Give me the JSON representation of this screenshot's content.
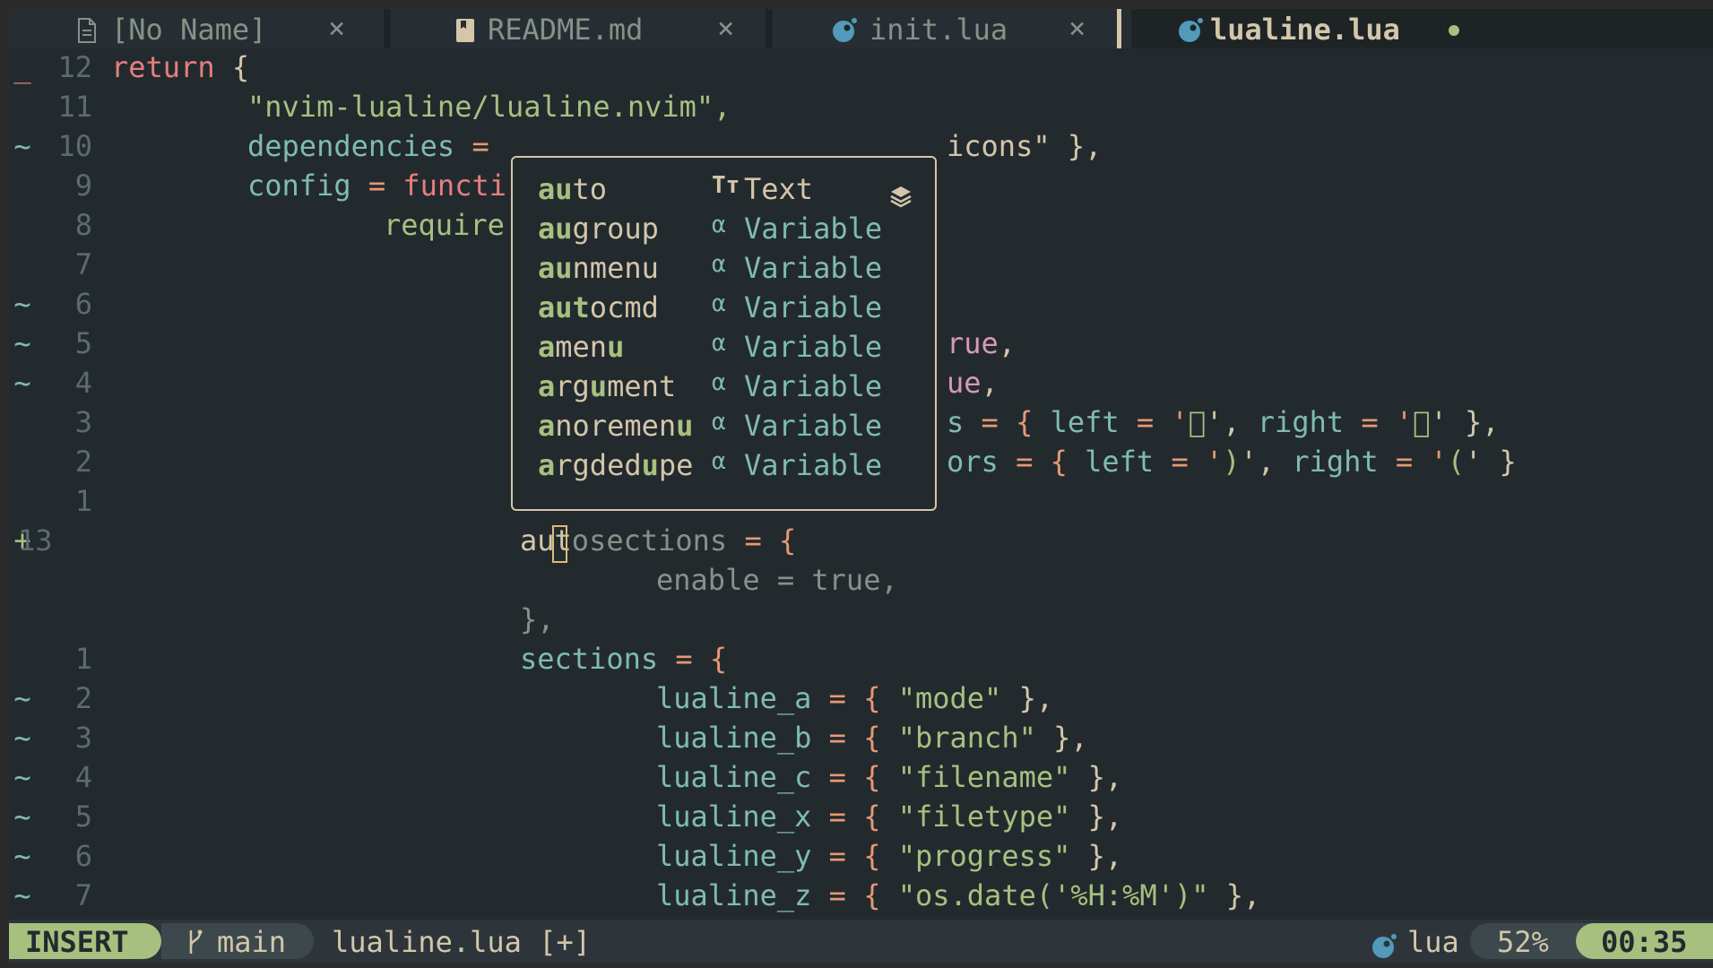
{
  "colors": {
    "background": "#232a2e",
    "accent_green": "#a7c080",
    "keyword_red": "#e67e80",
    "ident_aqua": "#7fbbb3",
    "operator_orange": "#e69875",
    "fg": "#d3c6aa"
  },
  "tabs": [
    {
      "title": "[No Name]",
      "icon": "file-icon",
      "close": "×",
      "active": false
    },
    {
      "title": "README.md",
      "icon": "markdown-file-icon",
      "close": "×",
      "active": false
    },
    {
      "title": "init.lua",
      "icon": "lua-icon",
      "close": "×",
      "active": false
    },
    {
      "title": "lualine.lua",
      "icon": "lua-icon",
      "modified": true,
      "active": true
    }
  ],
  "lines": [
    {
      "sign": "_",
      "num": "12"
    },
    {
      "sign": "",
      "num": "11"
    },
    {
      "sign": "~",
      "num": "10"
    },
    {
      "sign": "",
      "num": "9"
    },
    {
      "sign": "",
      "num": "8"
    },
    {
      "sign": "",
      "num": "7"
    },
    {
      "sign": "~",
      "num": "6"
    },
    {
      "sign": "~",
      "num": "5"
    },
    {
      "sign": "~",
      "num": "4"
    },
    {
      "sign": "",
      "num": "3"
    },
    {
      "sign": "",
      "num": "2"
    },
    {
      "sign": "",
      "num": "1"
    },
    {
      "sign": "+",
      "num": "13"
    },
    {
      "sign": "",
      "num": ""
    },
    {
      "sign": "",
      "num": ""
    },
    {
      "sign": "",
      "num": "1"
    },
    {
      "sign": "~",
      "num": "2"
    },
    {
      "sign": "~",
      "num": "3"
    },
    {
      "sign": "~",
      "num": "4"
    },
    {
      "sign": "~",
      "num": "5"
    },
    {
      "sign": "~",
      "num": "6"
    },
    {
      "sign": "~",
      "num": "7"
    }
  ],
  "code": {
    "l0_return": "return",
    "l0_brace": " {",
    "l1": "\"nvim-lualine/lualine.nvim\",",
    "l2_id": "dependencies",
    "l2_op": " =",
    "l2_tail": "icons\" },",
    "l3_id": "config",
    "l3_op": " = ",
    "l3_kw": "functi",
    "l4": "require",
    "l7_tail_a": "rue",
    "l7_tail_b": ",",
    "l8_tail_a": "ue",
    "l8_tail_b": ",",
    "l9_a": "s",
    "l9_b": " = { ",
    "l9_c": "left",
    "l9_d": " = '",
    "l9_e": "",
    "l9_f": "', ",
    "l9_g": "right",
    "l9_h": " = '",
    "l9_i": "",
    "l9_j": "' },",
    "l10_a": "ors",
    "l10_b": " = { ",
    "l10_c": "left",
    "l10_d": " = '",
    "l10_e": ")",
    "l10_f": "', ",
    "l10_g": "right",
    "l10_h": " = '",
    "l10_i": "(",
    "l10_j": "' }",
    "l12_a": "au",
    "l12_b": "t",
    "l12_c": "osections",
    "l12_d": " = {",
    "l13_a": "enable",
    "l13_b": " = ",
    "l13_c": "true",
    "l13_d": ",",
    "l14": "},",
    "l15_a": "sections",
    "l15_b": " = {",
    "sec": [
      {
        "name": "lualine_a",
        "val": "\"mode\""
      },
      {
        "name": "lualine_b",
        "val": "\"branch\""
      },
      {
        "name": "lualine_c",
        "val": "\"filename\""
      },
      {
        "name": "lualine_x",
        "val": "\"filetype\""
      },
      {
        "name": "lualine_y",
        "val": "\"progress\""
      },
      {
        "name": "lualine_z",
        "val": "\"os.date('%H:%M')\""
      }
    ],
    "eq_open": " = { ",
    "close": " },"
  },
  "completion": {
    "items": [
      {
        "label": "auto",
        "kind": "Text",
        "kind_icon": "text-type-icon"
      },
      {
        "label": "augroup",
        "kind": "Variable",
        "kind_icon": "alpha-icon"
      },
      {
        "label": "aunmenu",
        "kind": "Variable",
        "kind_icon": "alpha-icon"
      },
      {
        "label": "autocmd",
        "kind": "Variable",
        "kind_icon": "alpha-icon"
      },
      {
        "label": "amenu",
        "kind": "Variable",
        "kind_icon": "alpha-icon"
      },
      {
        "label": "argument",
        "kind": "Variable",
        "kind_icon": "alpha-icon"
      },
      {
        "label": "anoremenu",
        "kind": "Variable",
        "kind_icon": "alpha-icon"
      },
      {
        "label": "argdedupe",
        "kind": "Variable",
        "kind_icon": "alpha-icon"
      }
    ],
    "source_icon": "layers-icon"
  },
  "statusline": {
    "mode": "INSERT",
    "branch": "main",
    "filename": "lualine.lua [+]",
    "filetype": "lua",
    "progress": "52%",
    "time": "00:35"
  }
}
